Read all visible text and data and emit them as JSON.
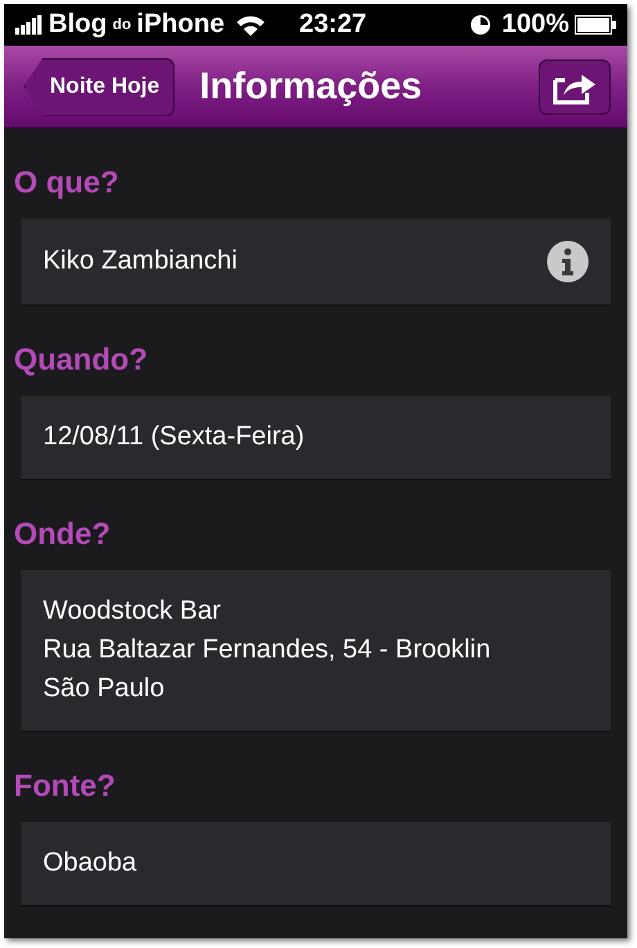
{
  "status_bar": {
    "carrier": "Blog",
    "carrier_mid": "do",
    "carrier_end": "iPhone",
    "time": "23:27",
    "battery": "100%"
  },
  "nav": {
    "back": "Noite Hoje",
    "title": "Informações"
  },
  "sections": [
    {
      "heading": "O que?",
      "lines": [
        "Kiko Zambianchi"
      ],
      "info": true
    },
    {
      "heading": "Quando?",
      "lines": [
        "12/08/11 (Sexta-Feira)"
      ],
      "info": false
    },
    {
      "heading": "Onde?",
      "lines": [
        "Woodstock Bar",
        "Rua Baltazar Fernandes, 54 - Brooklin",
        "São Paulo"
      ],
      "info": false
    },
    {
      "heading": "Fonte?",
      "lines": [
        "Obaoba"
      ],
      "info": false
    }
  ]
}
